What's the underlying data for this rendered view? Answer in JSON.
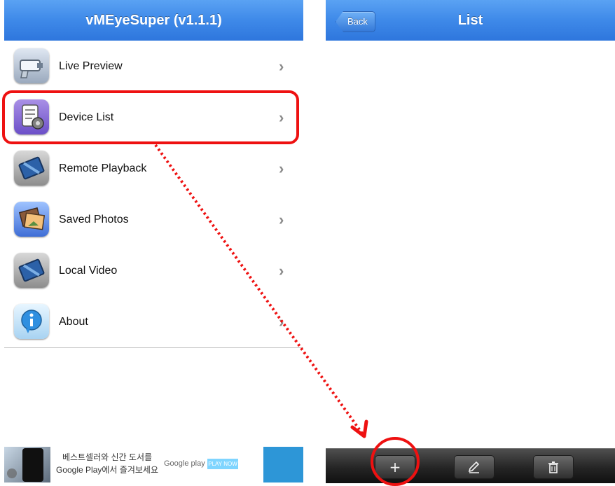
{
  "left": {
    "title": "vMEyeSuper (v1.1.1)",
    "menu": [
      {
        "label": "Live Preview",
        "icon": "camera-icon"
      },
      {
        "label": "Device List",
        "icon": "device-list-icon"
      },
      {
        "label": "Remote Playback",
        "icon": "film-icon"
      },
      {
        "label": "Saved Photos",
        "icon": "photos-icon"
      },
      {
        "label": "Local Video",
        "icon": "film-icon"
      },
      {
        "label": "About",
        "icon": "info-icon"
      }
    ],
    "ad": {
      "text_line1": "베스트셀러와 신간 도서를",
      "text_line2": "Google Play에서 즐겨보세요",
      "store": "Google play",
      "cta": "PLAY NOW"
    }
  },
  "right": {
    "title": "List",
    "back_label": "Back",
    "toolbar": [
      {
        "icon": "plus-icon"
      },
      {
        "icon": "pencil-icon"
      },
      {
        "icon": "trash-icon"
      }
    ]
  },
  "annotation_color": "#ee1111"
}
